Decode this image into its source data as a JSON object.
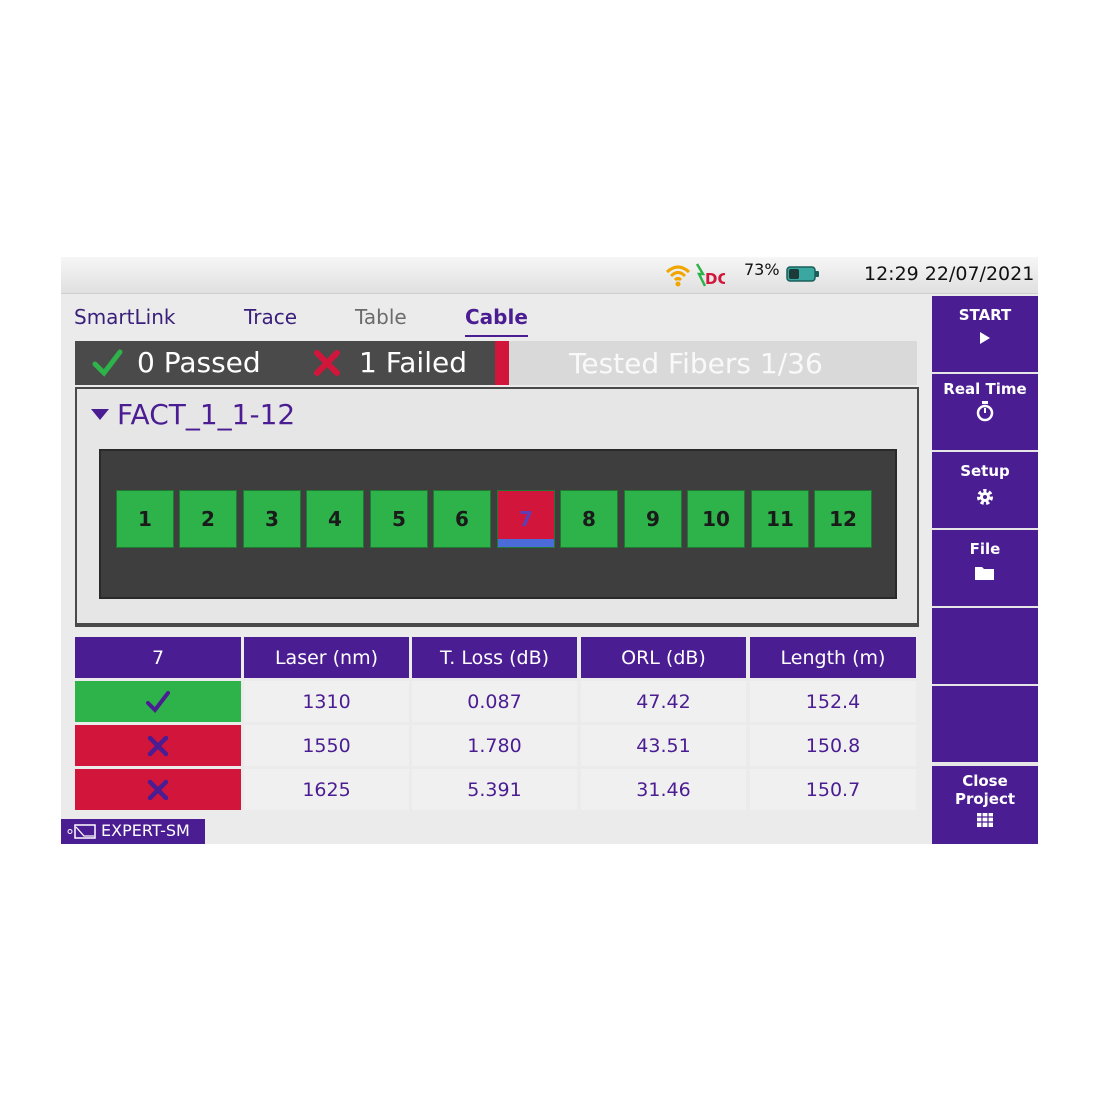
{
  "status_bar": {
    "battery_percent": "73%",
    "time_date": "12:29 22/07/2021",
    "icons": [
      "wifi-icon",
      "dc-power-icon",
      "battery-icon"
    ]
  },
  "tabs": [
    {
      "label": "SmartLink",
      "active": false
    },
    {
      "label": "Trace",
      "active": false
    },
    {
      "label": "Table",
      "active": false
    },
    {
      "label": "Cable",
      "active": true
    }
  ],
  "summary": {
    "passed": "0 Passed",
    "failed": "1 Failed",
    "tested": "Tested Fibers 1/36"
  },
  "cable": {
    "name": "FACT_1_1-12",
    "fibers": [
      {
        "label": "1",
        "status": "pass"
      },
      {
        "label": "2",
        "status": "pass"
      },
      {
        "label": "3",
        "status": "pass"
      },
      {
        "label": "4",
        "status": "pass"
      },
      {
        "label": "5",
        "status": "pass"
      },
      {
        "label": "6",
        "status": "pass"
      },
      {
        "label": "7",
        "status": "fail"
      },
      {
        "label": "8",
        "status": "pass"
      },
      {
        "label": "9",
        "status": "pass"
      },
      {
        "label": "10",
        "status": "pass"
      },
      {
        "label": "11",
        "status": "pass"
      },
      {
        "label": "12",
        "status": "pass"
      }
    ]
  },
  "results": {
    "headers": [
      "7",
      "Laser (nm)",
      "T. Loss (dB)",
      "ORL (dB)",
      "Length (m)"
    ],
    "rows": [
      {
        "status": "pass",
        "laser": "1310",
        "loss": "0.087",
        "orl": "47.42",
        "length": "152.4"
      },
      {
        "status": "fail",
        "laser": "1550",
        "loss": "1.780",
        "orl": "43.51",
        "length": "150.8"
      },
      {
        "status": "fail",
        "laser": "1625",
        "loss": "5.391",
        "orl": "31.46",
        "length": "150.7"
      }
    ]
  },
  "side_panel": {
    "start": "START",
    "real_time": "Real Time",
    "setup": "Setup",
    "file": "File",
    "close_project": "Close Project"
  },
  "bottom_bar": {
    "mode": "EXPERT-SM"
  },
  "colors": {
    "accent": "#4b1d92",
    "pass": "#2eb34a",
    "fail": "#d2163b"
  }
}
